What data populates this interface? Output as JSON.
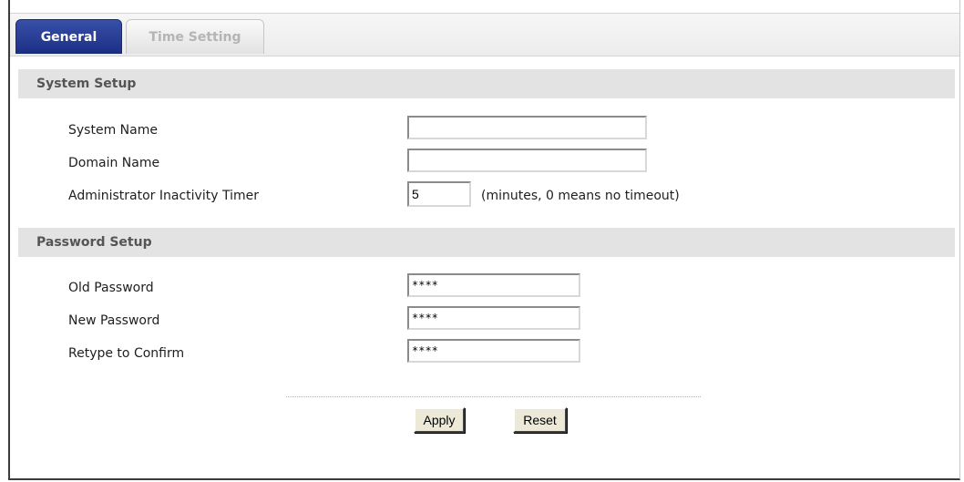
{
  "tabs": {
    "general": "General",
    "time_setting": "Time Setting"
  },
  "system_setup": {
    "title": "System Setup",
    "system_name_label": "System Name",
    "system_name_value": "",
    "domain_name_label": "Domain Name",
    "domain_name_value": "",
    "inactivity_label": "Administrator Inactivity Timer",
    "inactivity_value": "5",
    "inactivity_hint": "(minutes, 0 means no timeout)"
  },
  "password_setup": {
    "title": "Password Setup",
    "old_label": "Old Password",
    "old_value": "****",
    "new_label": "New Password",
    "new_value": "****",
    "retype_label": "Retype to Confirm",
    "retype_value": "****"
  },
  "buttons": {
    "apply": "Apply",
    "reset": "Reset"
  },
  "colors": {
    "active_tab": "#1c2f86",
    "section_header_bg": "#e3e3e3"
  }
}
